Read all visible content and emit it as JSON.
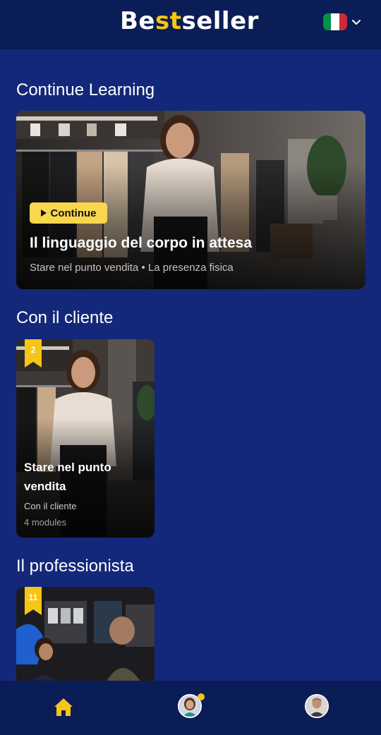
{
  "header": {
    "logo_part1": "Be",
    "logo_accent": "st",
    "logo_part2": "seller",
    "language": "Italiano",
    "flag_colors": [
      "#009246",
      "#ffffff",
      "#ce2b37"
    ],
    "icons": [
      "italy-flag-icon",
      "chevron-down-icon"
    ]
  },
  "continue_learning": {
    "section_title": "Continue Learning",
    "button_label": "Continue",
    "title": "Il linguaggio del corpo in attesa",
    "subtitle": "Stare nel punto vendita • La presenza fisica"
  },
  "sections": [
    {
      "title": "Con il cliente",
      "courses": [
        {
          "badge": "2",
          "title": "Stare nel punto vendita",
          "category": "Con il cliente",
          "modules": "4 modules"
        }
      ]
    },
    {
      "title": "Il professionista",
      "courses": [
        {
          "badge": "11"
        }
      ]
    }
  ],
  "bottom_nav": {
    "items": [
      "home-icon",
      "coach-avatar",
      "profile-avatar"
    ],
    "active": "home-icon"
  },
  "colors": {
    "background": "#13287a",
    "header": "#0b1d57",
    "accent": "#f5c518",
    "button": "#f8d64e"
  }
}
